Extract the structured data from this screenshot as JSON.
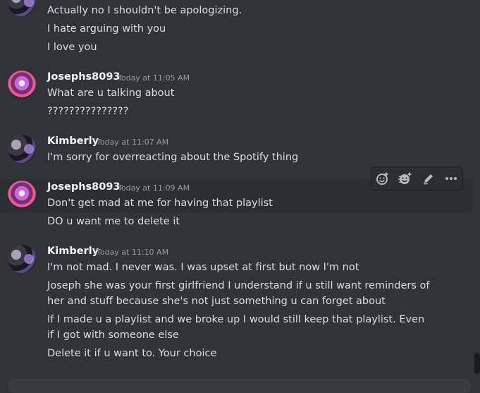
{
  "messages": [
    {
      "author": "",
      "time": "",
      "avatar": "kim",
      "lines": [
        "Actually no I shouldn't be apologizing.",
        "I hate arguing with you",
        "I love you"
      ]
    },
    {
      "author": "Josephs8093",
      "time": "Today at 11:05 AM",
      "avatar": "jos",
      "lines": [
        "What are u talking about",
        "???????????????"
      ]
    },
    {
      "author": "Kimberly",
      "time": "Today at 11:07 AM",
      "avatar": "kim",
      "lines": [
        "I'm sorry for overreacting about the Spotify thing"
      ]
    },
    {
      "author": "Josephs8093",
      "time": "Today at 11:09 AM",
      "avatar": "jos",
      "lines": [
        "Don't get mad at me for having that playlist",
        "DO u want me to delete  it"
      ]
    },
    {
      "author": "Kimberly",
      "time": "Today at 11:10 AM",
      "avatar": "kim",
      "lines": [
        "I'm not mad. I never was. I was upset at first but now I'm not",
        "Joseph she was your first girlfriend I understand if u still want reminders of her and stuff because she's not just something u can forget about",
        "If I made u a playlist and we broke up I would still keep that playlist. Even if I got with someone else",
        "Delete it if u want to. Your choice"
      ]
    }
  ],
  "toolbar": {
    "icons": [
      "add-reaction-icon",
      "super-reaction-icon",
      "edit-icon",
      "more-icon"
    ],
    "icon_color": "#b5bac1"
  },
  "colors": {
    "background": "#323339",
    "name": "#f2f3f5",
    "timestamp": "#949ba4",
    "text": "#dbdee1"
  }
}
